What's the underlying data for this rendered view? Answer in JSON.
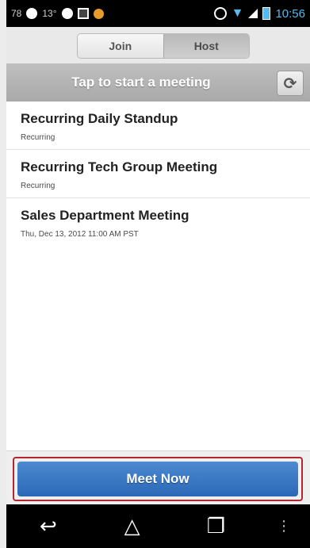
{
  "status_bar": {
    "left_text": "78",
    "temp_text": "13°",
    "time": "10:56"
  },
  "segmented": {
    "join_label": "Join",
    "host_label": "Host",
    "selected": "Host"
  },
  "header": {
    "title": "Tap to start a meeting"
  },
  "meetings": [
    {
      "title": "Recurring Daily Standup",
      "subtitle": "Recurring"
    },
    {
      "title": "Recurring Tech Group Meeting",
      "subtitle": "Recurring"
    },
    {
      "title": "Sales Department Meeting",
      "subtitle": "Thu, Dec 13, 2012 11:00 AM PST"
    }
  ],
  "bottom": {
    "meet_now_label": "Meet Now"
  },
  "colors": {
    "primary_button": "#2a68b7",
    "highlight_border": "#b3262f",
    "status_accent": "#57b9ea"
  },
  "icons": {
    "refresh": "refresh-icon",
    "back": "back-icon",
    "home": "home-icon",
    "recents": "recent-apps-icon",
    "menu": "overflow-menu-icon"
  }
}
